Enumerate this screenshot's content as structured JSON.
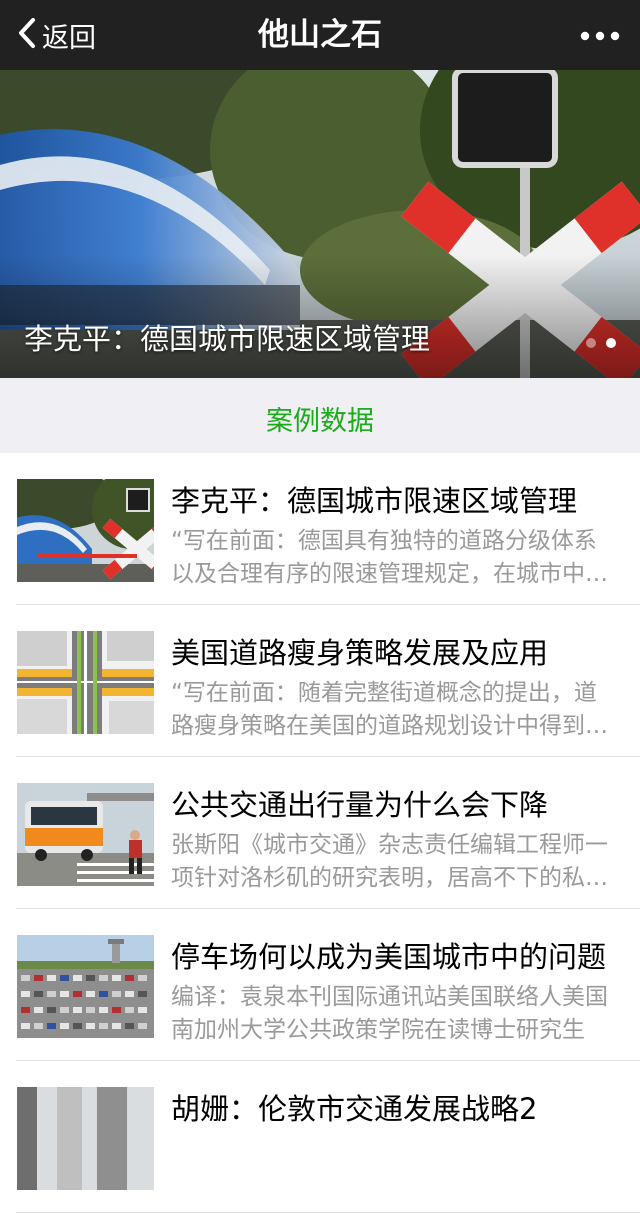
{
  "nav": {
    "back_label": "返回",
    "title": "他山之石"
  },
  "banner": {
    "caption": "李克平：德国城市限速区域管理",
    "slide_count": 2,
    "active_slide": 2
  },
  "section": {
    "title": "案例数据"
  },
  "colors": {
    "navbar_bg": "#212121",
    "accent_green": "#1aad19",
    "section_bg": "#efeff4",
    "desc_gray": "#9a9a9a"
  },
  "articles": [
    {
      "title": "李克平：德国城市限速区域管理",
      "desc": "“写在前面：德国具有独特的道路分级体系以及合理有序的限速管理规定，在城市中划定限速区域"
    },
    {
      "title": "美国道路瘦身策略发展及应用",
      "desc": "“写在前面：随着完整街道概念的提出，道路瘦身策略在美国的道路规划设计中得到广泛应用"
    },
    {
      "title": "公共交通出行量为什么会下降",
      "desc": "张斯阳《城市交通》杂志责任编辑工程师一项针对洛杉矶的研究表明，居高不下的私人小汽车"
    },
    {
      "title": "停车场何以成为美国城市中的问题",
      "desc": "编译：袁泉本刊国际通讯站美国联络人美国南加州大学公共政策学院在读博士研究生"
    },
    {
      "title": "胡姗：伦敦市交通发展战略2",
      "desc": ""
    }
  ]
}
